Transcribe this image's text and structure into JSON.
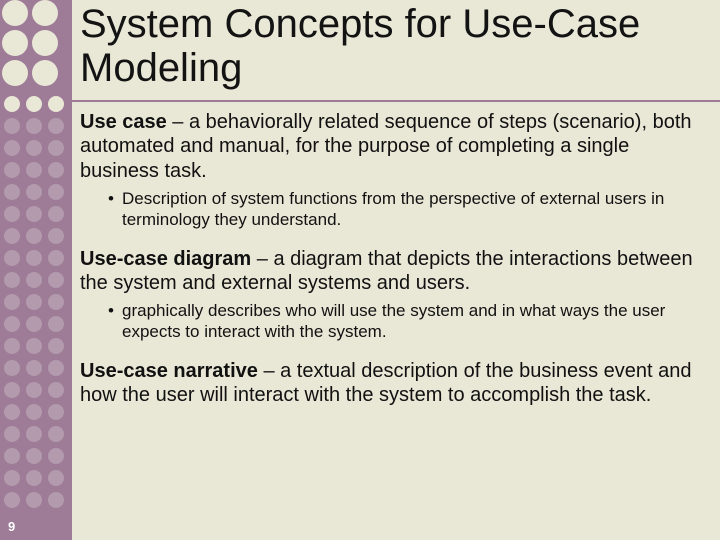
{
  "slide": {
    "number": "9",
    "title": "System Concepts for Use-Case Modeling",
    "defs": [
      {
        "term": "Use case",
        "text": " – a behaviorally related sequence of steps (scenario), both automated and manual, for the purpose of completing a single business task.",
        "bullet": "Description of system functions from the perspective of external users in terminology they understand."
      },
      {
        "term": "Use-case diagram",
        "text": " – a diagram that depicts the interactions between the system and external systems and users.",
        "bullet": "graphically describes who will use the system and in what ways the user expects to interact with the system."
      },
      {
        "term": "Use-case narrative",
        "text": " – a textual description of the business event and how the user will interact with the system to accomplish the task.",
        "bullet": null
      }
    ]
  }
}
